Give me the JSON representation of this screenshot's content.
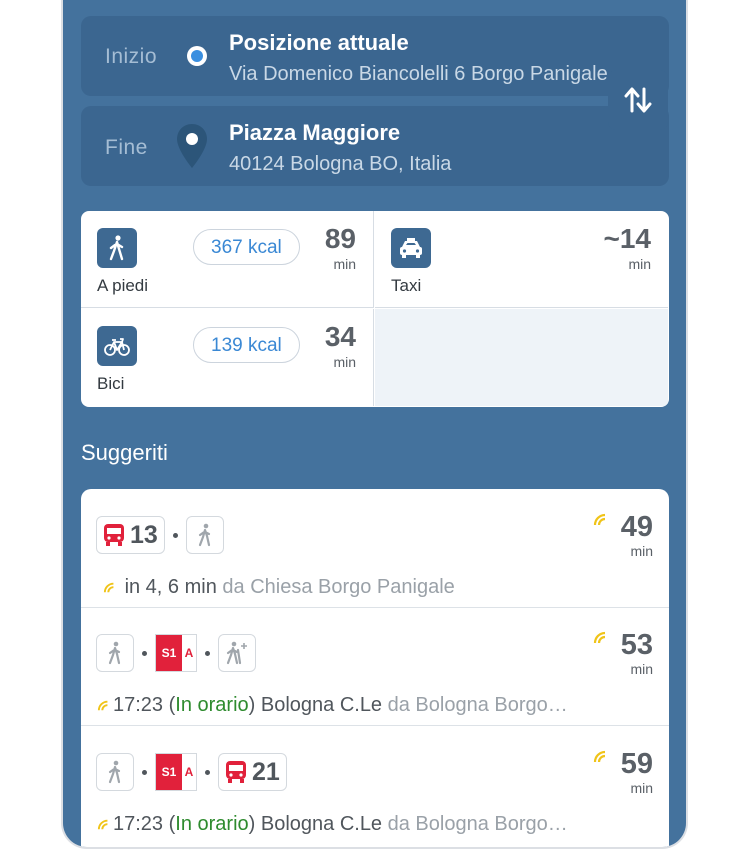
{
  "route": {
    "start_label": "Inizio",
    "start_title": "Posizione attuale",
    "start_subtitle": "Via Domenico Biancolelli 6 Borgo Panigale",
    "end_label": "Fine",
    "end_title": "Piazza Maggiore",
    "end_subtitle": "40124 Bologna BO, Italia"
  },
  "modes": [
    {
      "name": "A piedi",
      "kcal": "367 kcal",
      "time": "89",
      "unit": "min",
      "icon": "walk-icon"
    },
    {
      "name": "Taxi",
      "time": "~14",
      "unit": "min",
      "icon": "taxi-icon"
    },
    {
      "name": "Bici",
      "kcal": "139 kcal",
      "time": "34",
      "unit": "min",
      "icon": "bike-icon"
    }
  ],
  "section_title": "Suggeriti",
  "suggestions": [
    {
      "line_number": "13",
      "time": "49",
      "unit": "min",
      "detail_main": "in 4, 6 min",
      "detail_muted": " da Chiesa Borgo Panigale"
    },
    {
      "badge_left": "S1",
      "badge_right": "A",
      "time": "53",
      "unit": "min",
      "detail_time": "17:23 (",
      "detail_status": "In orario",
      "detail_mid": ") Bologna C.Le",
      "detail_muted": " da Bologna Borgo…"
    },
    {
      "badge_left": "S1",
      "badge_right": "A",
      "line_number": "21",
      "time": "59",
      "unit": "min",
      "detail_time": "17:23 (",
      "detail_status": "In orario",
      "detail_mid": ") Bologna C.Le",
      "detail_muted": " da Bologna Borgo…"
    }
  ],
  "colors": {
    "background": "#44729d",
    "accent_blue": "#3a88d4",
    "bus_red": "#e1213b",
    "status_green": "#2e8b2e",
    "realtime_yellow": "#f0c419"
  }
}
